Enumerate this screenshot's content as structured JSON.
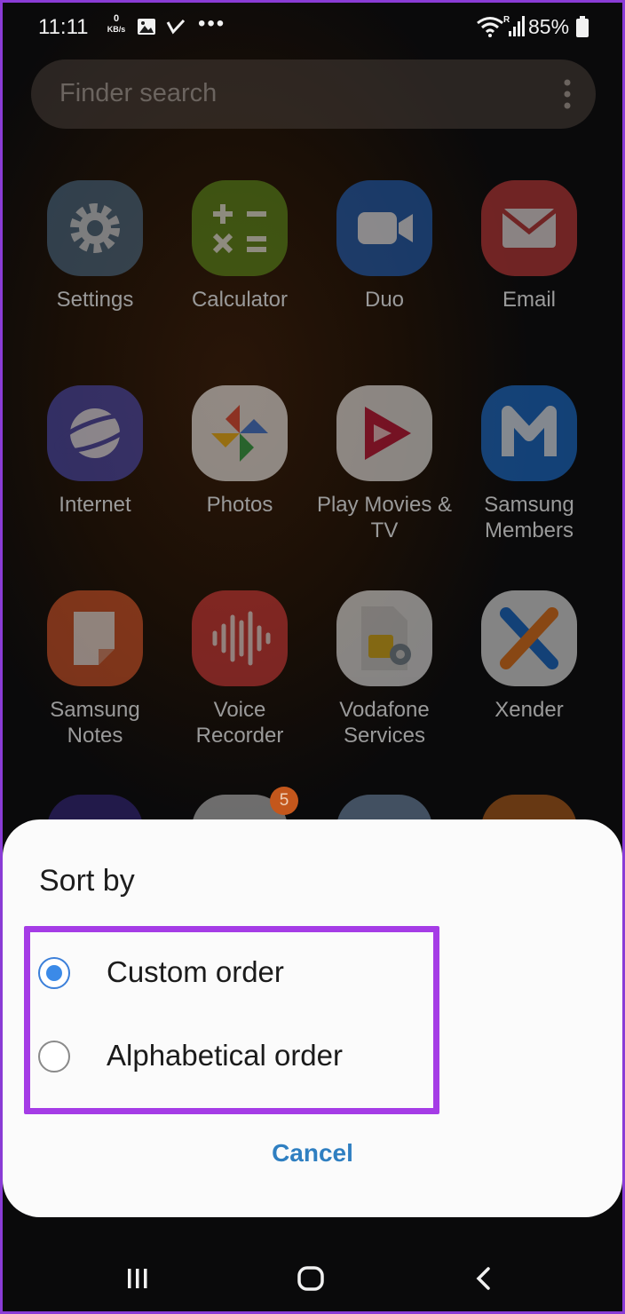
{
  "status_bar": {
    "time": "11:11",
    "net_speed_value": "0",
    "net_speed_unit": "KB/s",
    "overflow": "•••",
    "battery": "85%",
    "icons": [
      "image-icon",
      "check-icon",
      "wifi-icon",
      "signal-icon",
      "battery-icon"
    ]
  },
  "search": {
    "placeholder": "Finder search",
    "more_icon": "more-vertical-icon"
  },
  "apps": [
    {
      "label": "Settings",
      "icon": "gear-icon",
      "color": "#4a6a86"
    },
    {
      "label": "Calculator",
      "icon": "calculator-icon",
      "color": "#5a8a1c"
    },
    {
      "label": "Duo",
      "icon": "video-icon",
      "color": "#1f5fb8"
    },
    {
      "label": "Email",
      "icon": "mail-icon",
      "color": "#c43a3a"
    },
    {
      "label": "Internet",
      "icon": "planet-icon",
      "color": "#4a4ab0"
    },
    {
      "label": "Photos",
      "icon": "pinwheel-icon",
      "color": "#e8e8e8"
    },
    {
      "label": "Play Movies & TV",
      "icon": "play-movies-icon",
      "color": "#e8e8e8"
    },
    {
      "label": "Samsung Members",
      "icon": "members-icon",
      "color": "#1c6fd0"
    },
    {
      "label": "Samsung Notes",
      "icon": "notes-icon",
      "color": "#d6562a"
    },
    {
      "label": "Voice Recorder",
      "icon": "waveform-icon",
      "color": "#d23a3a"
    },
    {
      "label": "Vodafone Services",
      "icon": "sim-card-icon",
      "color": "#e8e8e8"
    },
    {
      "label": "Xender",
      "icon": "xender-icon",
      "color": "#e8e8e8"
    }
  ],
  "notification_badge": "5",
  "sheet": {
    "title": "Sort by",
    "options": [
      {
        "label": "Custom order",
        "selected": true
      },
      {
        "label": "Alphabetical order",
        "selected": false
      }
    ],
    "cancel": "Cancel",
    "highlight_color": "#a53ce6",
    "accent_color": "#3b8ae8"
  },
  "nav": {
    "recents": "recents-icon",
    "home": "home-icon",
    "back": "back-icon"
  }
}
